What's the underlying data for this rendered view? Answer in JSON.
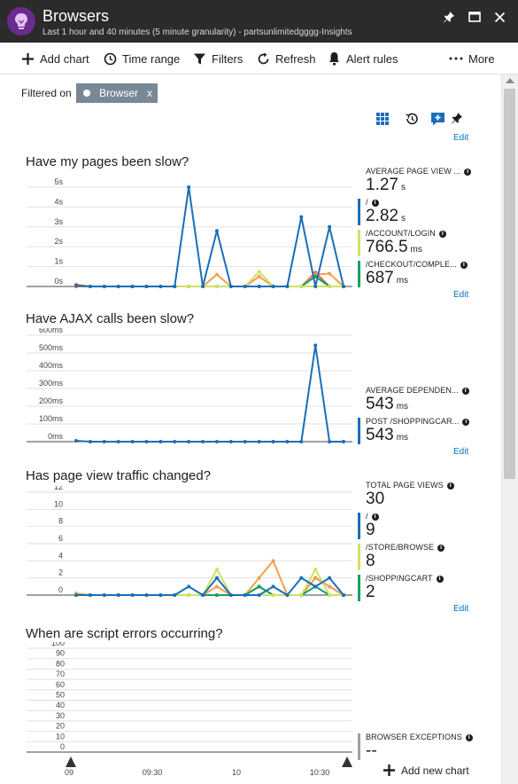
{
  "header": {
    "title": "Browsers",
    "subtitle": "Last 1 hour and 40 minutes (5 minute granularity) - partsunlimitedgggg-Insights"
  },
  "toolbar": {
    "add_chart": "Add chart",
    "time_range": "Time range",
    "filters": "Filters",
    "refresh": "Refresh",
    "alert_rules": "Alert rules",
    "more": "More"
  },
  "filter": {
    "label": "Filtered on",
    "chip": "Browser",
    "remove": "x"
  },
  "edit_label": "Edit",
  "add_new_chart": "Add new chart",
  "colors": {
    "blue": "#1a6eb8",
    "orange": "#f2a04c",
    "yellow_green": "#cde264",
    "green": "#15a160",
    "red": "#e85a4f",
    "pink": "#f0a0a8",
    "gray_bar": "#a0a0a0"
  },
  "chart_data": [
    {
      "type": "line",
      "title": "Have my pages been slow?",
      "y_ticks": [
        "5s",
        "4s",
        "3s",
        "2s",
        "1s",
        "0s"
      ],
      "ylim": [
        0,
        5.4
      ],
      "x": [
        0,
        1,
        2,
        3,
        4,
        5,
        6,
        7,
        8,
        9,
        10,
        11,
        12,
        13,
        14,
        15,
        16,
        17,
        18,
        19
      ],
      "series": [
        {
          "name": "/",
          "color": "#1a6eb8",
          "values": [
            0.05,
            0,
            0,
            0,
            0,
            0,
            0,
            0,
            5.0,
            0,
            2.8,
            0,
            0,
            0,
            0,
            0,
            3.5,
            0,
            3.0,
            0
          ]
        },
        {
          "name": "/ACCOUNT/LOGIN",
          "color": "#cde264",
          "values": [
            0.05,
            0,
            0,
            0,
            0,
            0,
            0,
            0,
            0,
            0,
            0,
            0,
            0,
            0.75,
            0,
            0,
            0,
            0,
            0,
            0
          ]
        },
        {
          "name": "/CHECKOUT/COMPLE...",
          "color": "#15a160",
          "values": [
            0.05,
            0,
            0,
            0,
            0,
            0,
            0,
            0,
            0,
            0,
            0,
            0,
            0,
            0,
            0,
            0,
            0,
            0.5,
            0,
            0
          ]
        },
        {
          "name": "",
          "color": "#f2a04c",
          "values": [
            0.1,
            0,
            0,
            0,
            0,
            0,
            0,
            0,
            0,
            0,
            0.6,
            0,
            0,
            0.5,
            0,
            0,
            0,
            0.6,
            0.65,
            0
          ]
        },
        {
          "name": "",
          "color": "#e85a4f",
          "values": [
            0,
            0,
            0,
            0,
            0,
            0,
            0,
            0,
            0,
            0,
            0,
            0,
            0,
            0,
            0,
            0,
            0,
            0.7,
            0,
            0
          ]
        }
      ],
      "metrics": [
        {
          "label": "AVERAGE PAGE VIEW ...",
          "value": "1.27",
          "unit": "s",
          "bar": ""
        },
        {
          "label": "/",
          "value": "2.82",
          "unit": "s",
          "bar": "#1a6eb8"
        },
        {
          "label": "/ACCOUNT/LOGIN",
          "value": "766.5",
          "unit": "ms",
          "bar": "#cde264"
        },
        {
          "label": "/CHECKOUT/COMPLE...",
          "value": "687",
          "unit": "ms",
          "bar": "#15a160"
        }
      ]
    },
    {
      "type": "line",
      "title": "Have AJAX calls been slow?",
      "y_ticks": [
        "600ms",
        "500ms",
        "400ms",
        "300ms",
        "200ms",
        "100ms",
        "0ms"
      ],
      "ylim": [
        0,
        620
      ],
      "x": [
        0,
        1,
        2,
        3,
        4,
        5,
        6,
        7,
        8,
        9,
        10,
        11,
        12,
        13,
        14,
        15,
        16,
        17,
        18,
        19
      ],
      "series": [
        {
          "name": "POST /SHOPPINGCAR...",
          "color": "#1a6eb8",
          "values": [
            5,
            0,
            0,
            0,
            0,
            0,
            0,
            0,
            0,
            0,
            0,
            0,
            0,
            0,
            0,
            0,
            0,
            543,
            0,
            0
          ]
        }
      ],
      "metrics": [
        {
          "label": "AVERAGE DEPENDEN...",
          "value": "543",
          "unit": "ms",
          "bar": ""
        },
        {
          "label": "POST /SHOPPINGCAR...",
          "value": "543",
          "unit": "ms",
          "bar": "#1a6eb8"
        }
      ]
    },
    {
      "type": "line",
      "title": "Has page view traffic changed?",
      "y_ticks": [
        "12",
        "10",
        "8",
        "6",
        "4",
        "2",
        "0"
      ],
      "ylim": [
        0,
        12.5
      ],
      "x": [
        0,
        1,
        2,
        3,
        4,
        5,
        6,
        7,
        8,
        9,
        10,
        11,
        12,
        13,
        14,
        15,
        16,
        17,
        18,
        19
      ],
      "series": [
        {
          "name": "/",
          "color": "#1a6eb8",
          "values": [
            0,
            0,
            0,
            0,
            0,
            0,
            0,
            0,
            1,
            0,
            2,
            0,
            0,
            0,
            1,
            0,
            2,
            1,
            2,
            0
          ]
        },
        {
          "name": "/STORE/BROWSE",
          "color": "#cde264",
          "values": [
            0,
            0,
            0,
            0,
            0,
            0,
            0,
            0,
            0,
            0,
            3,
            0,
            0,
            0,
            0,
            0,
            0,
            3,
            0,
            0
          ]
        },
        {
          "name": "/SHOPPINGCART",
          "color": "#15a160",
          "values": [
            0,
            0,
            0,
            0,
            0,
            0,
            0,
            0,
            0,
            0,
            0,
            0,
            0,
            1,
            0,
            0,
            0,
            1,
            0,
            0
          ]
        },
        {
          "name": "",
          "color": "#f2a04c",
          "values": [
            0.2,
            0,
            0,
            0,
            0,
            0,
            0,
            0,
            0,
            0,
            1,
            0,
            0,
            2,
            4,
            0,
            0,
            2,
            1,
            0
          ]
        },
        {
          "name": "",
          "color": "#e85a4f",
          "values": [
            0,
            0,
            0,
            0,
            0,
            0,
            0,
            0,
            0,
            0,
            0,
            0,
            0,
            1,
            0,
            0,
            0,
            2,
            1,
            0
          ]
        }
      ],
      "metrics": [
        {
          "label": "TOTAL PAGE VIEWS",
          "value": "30",
          "unit": "",
          "bar": ""
        },
        {
          "label": "/",
          "value": "9",
          "unit": "",
          "bar": "#1a6eb8"
        },
        {
          "label": "/STORE/BROWSE",
          "value": "8",
          "unit": "",
          "bar": "#cde264"
        },
        {
          "label": "/SHOPPINGCART",
          "value": "2",
          "unit": "",
          "bar": "#15a160"
        }
      ]
    },
    {
      "type": "line",
      "title": "When are script errors occurring?",
      "y_ticks": [
        "100",
        "90",
        "80",
        "70",
        "60",
        "50",
        "40",
        "30",
        "20",
        "10",
        "0"
      ],
      "ylim": [
        0,
        100
      ],
      "x_ticks": [
        "09",
        "09:30",
        "10",
        "10:30"
      ],
      "series": [],
      "metrics": [
        {
          "label": "BROWSER EXCEPTIONS",
          "value": "--",
          "unit": "",
          "bar": "#a0a0a0"
        }
      ]
    }
  ]
}
